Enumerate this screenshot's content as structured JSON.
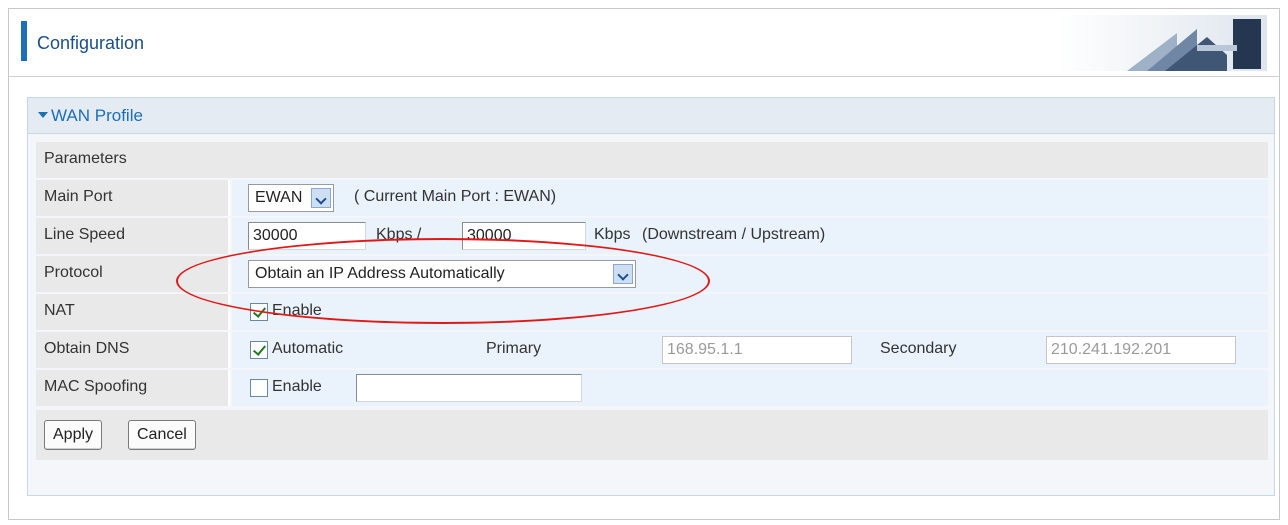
{
  "header": {
    "title": "Configuration"
  },
  "panel": {
    "title": "WAN Profile",
    "section_label": "Parameters",
    "main_port": {
      "label": "Main Port",
      "value": "EWAN",
      "note": "( Current Main Port : EWAN)"
    },
    "line_speed": {
      "label": "Line Speed",
      "down_value": "30000",
      "unit1": "Kbps  /",
      "up_value": "30000",
      "unit2": "Kbps",
      "note": "(Downstream / Upstream)"
    },
    "protocol": {
      "label": "Protocol",
      "value": "Obtain an IP Address Automatically"
    },
    "nat": {
      "label": "NAT",
      "checked": true,
      "option": "Enable"
    },
    "obtain_dns": {
      "label": "Obtain DNS",
      "checked": true,
      "option": "Automatic",
      "primary_label": "Primary",
      "primary_value": "168.95.1.1",
      "secondary_label": "Secondary",
      "secondary_value": "210.241.192.201"
    },
    "mac_spoofing": {
      "label": "MAC Spoofing",
      "checked": false,
      "option": "Enable",
      "value": ""
    },
    "buttons": {
      "apply": "Apply",
      "cancel": "Cancel"
    }
  },
  "colors": {
    "accent": "#1b6fb5",
    "highlight_ellipse": "#e01818"
  }
}
